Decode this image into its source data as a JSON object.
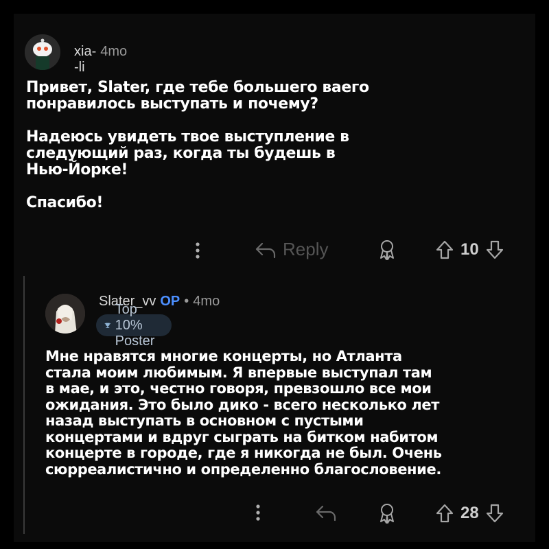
{
  "comment1": {
    "username": "xia--li",
    "time": "4mo",
    "paragraphs": [
      "Привет, Slater, где тебе большего ваего\nпонравилось выступать и почему?",
      "Надеюсь увидеть твое выступление в\nследующий раз, когда ты будешь в\nНью-Йорке!",
      "Спасибо!"
    ],
    "actions": {
      "reply_label": "Reply",
      "votes": "10"
    }
  },
  "comment2": {
    "username": "Slater_vv",
    "op_label": "OP",
    "separator": "•",
    "time": "4mo",
    "badge": "Top 10% Poster",
    "paragraphs": [
      "Мне нравятся многие концерты, но Атланта\nстала моим любимым. Я впервые выступал там\nв мае, и это, честно говоря, превзошло все мои\nожидания. Это было дико - всего несколько лет\nназад выступать в основном с пустыми\nконцертами и вдруг сыграть на битком набитом\nконцерте в городе, где я никогда не был. Очень\nсюрреалистично и определенно благословение."
    ],
    "actions": {
      "votes": "28"
    }
  },
  "icons": {
    "more": "more-vertical-icon",
    "reply": "reply-arrow-icon",
    "award": "award-icon",
    "upvote": "upvote-arrow-icon",
    "downvote": "downvote-arrow-icon",
    "badge": "trophy-icon"
  },
  "colors": {
    "background": "#0b0b0b",
    "op_accent": "#4c8fff",
    "badge_bg": "#1f2a36",
    "muted": "#a6a6a6"
  }
}
